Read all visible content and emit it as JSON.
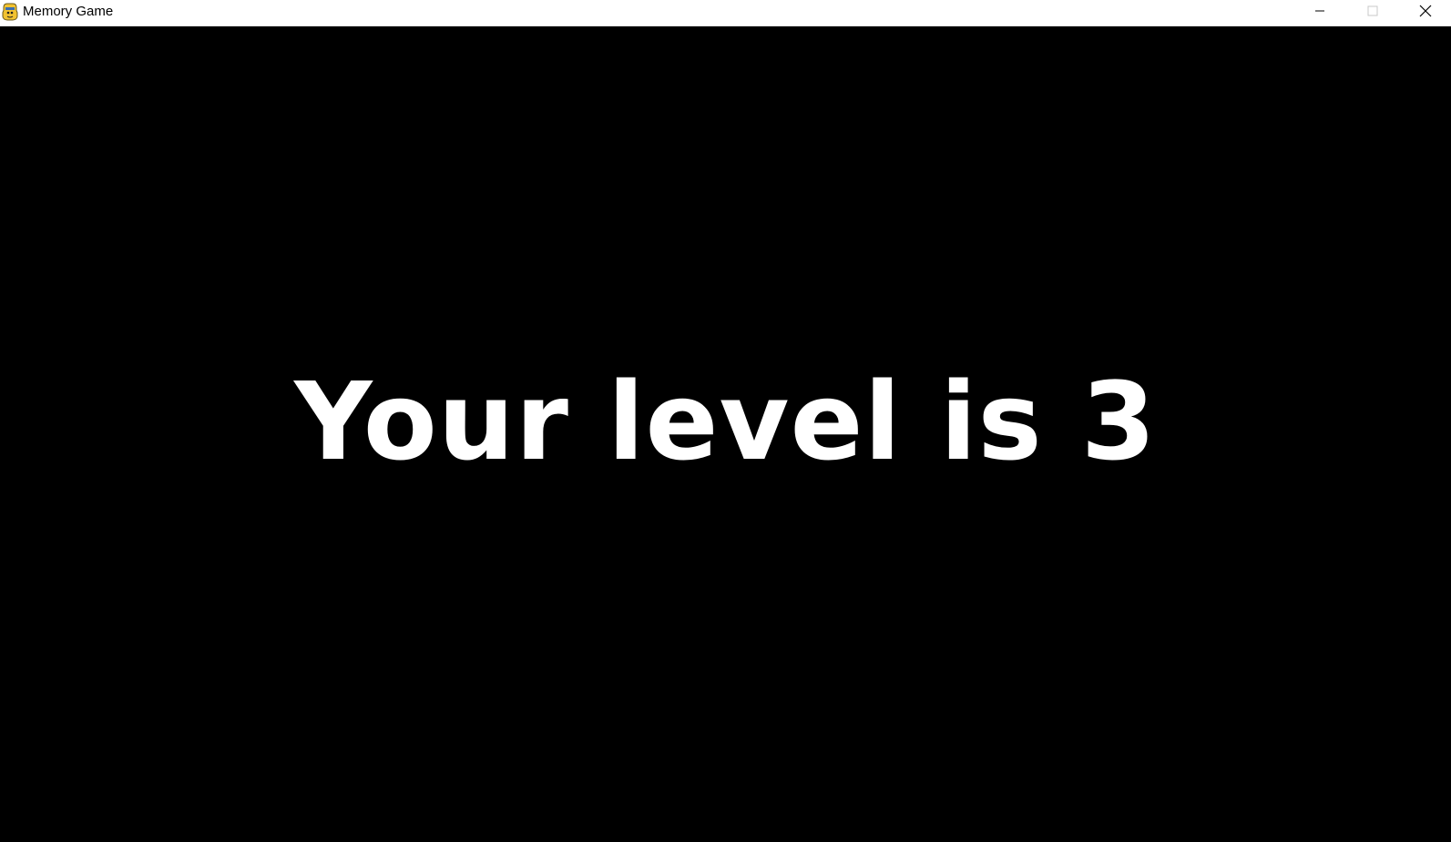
{
  "window": {
    "title": "Memory Game",
    "app_icon": "pygame-snake-icon",
    "controls": {
      "minimize_icon": "minimize-icon",
      "maximize_icon": "maximize-icon",
      "close_icon": "close-icon"
    }
  },
  "game": {
    "message": "Your level is 3",
    "level": 3
  },
  "colors": {
    "background": "#000000",
    "text": "#ffffff",
    "titlebar": "#ffffff"
  }
}
